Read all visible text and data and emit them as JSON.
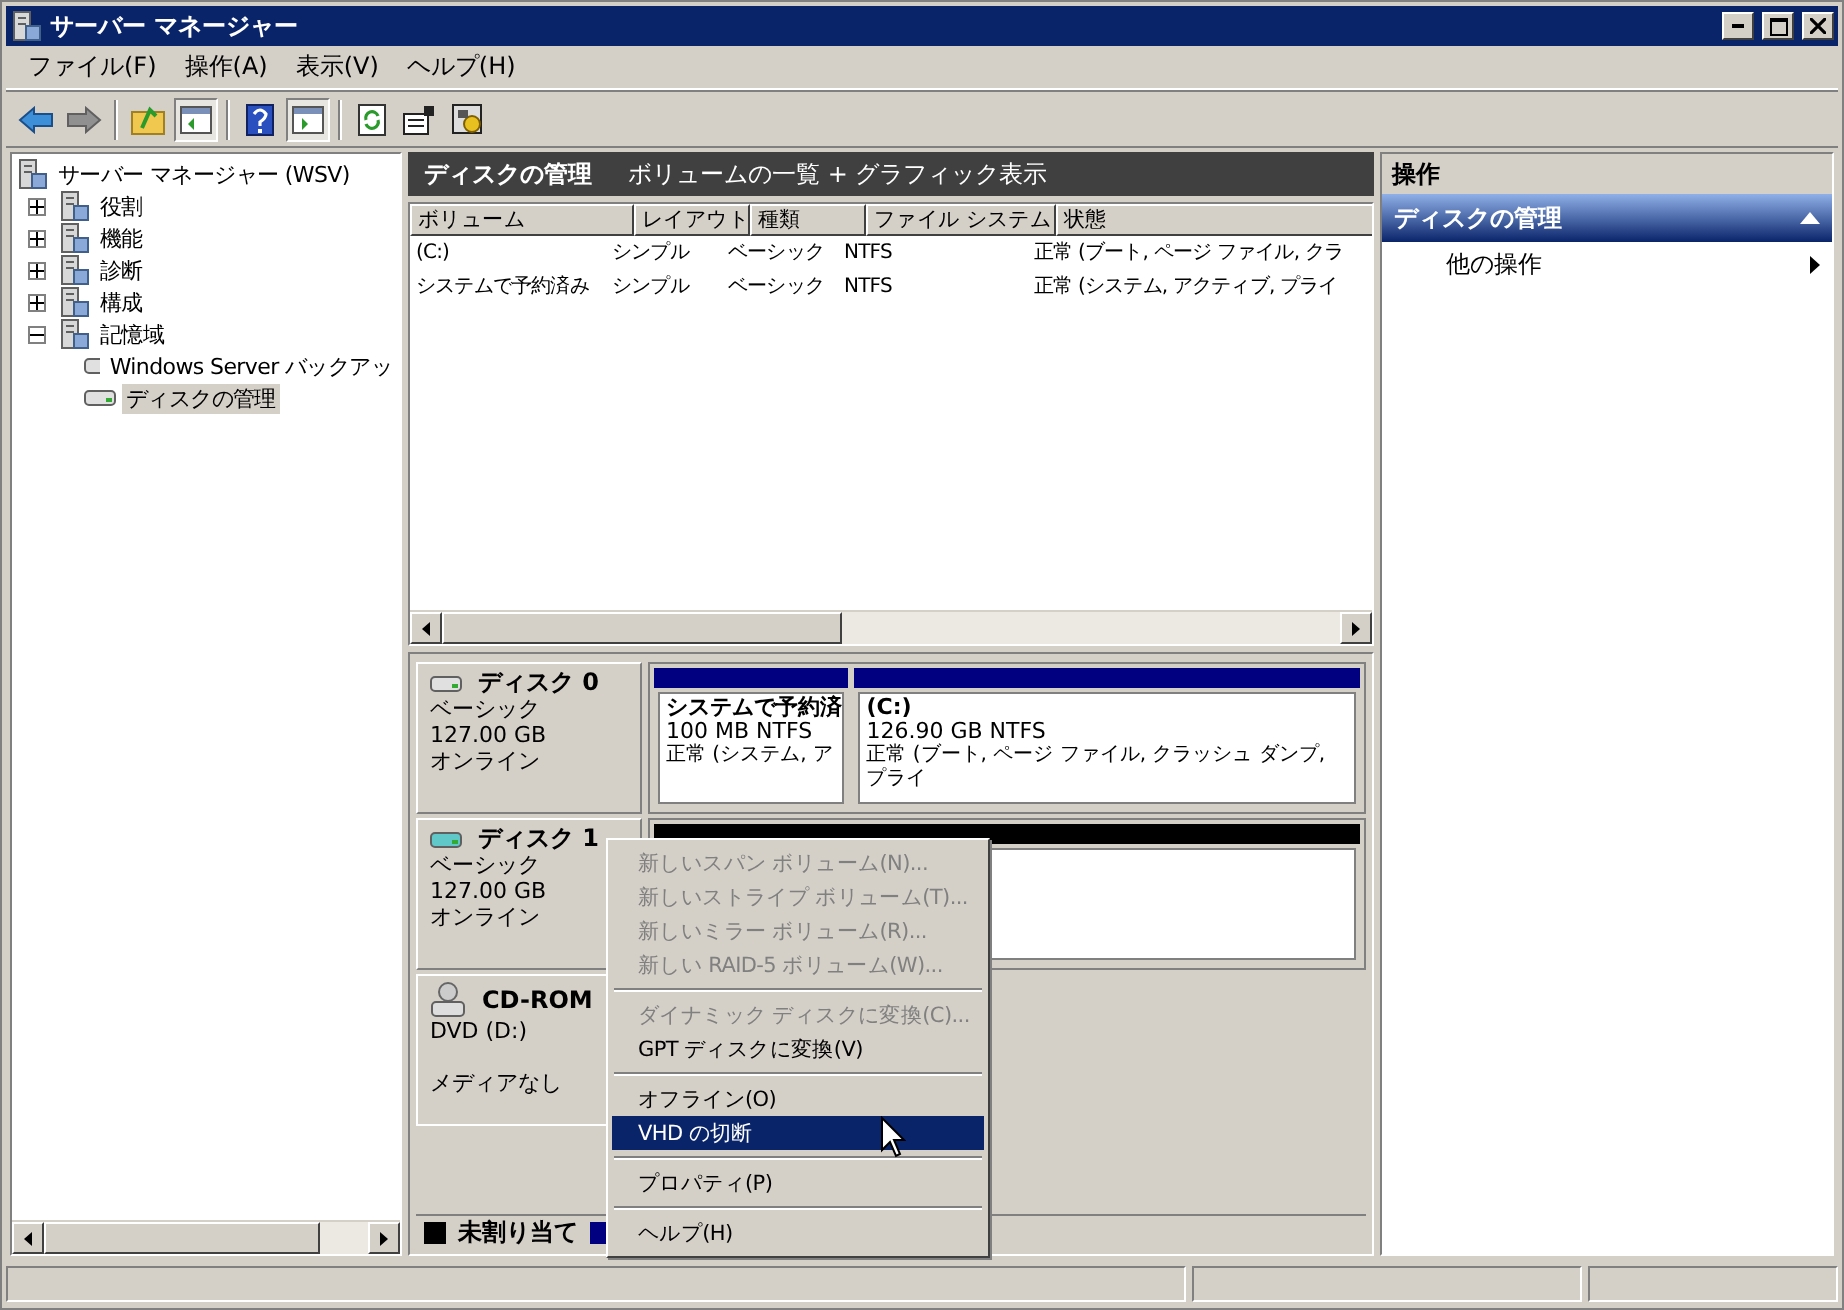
{
  "window": {
    "title": "サーバー マネージャー"
  },
  "menu_bar": [
    "ファイル(F)",
    "操作(A)",
    "表示(V)",
    "ヘルプ(H)"
  ],
  "toolbar": [
    {
      "kind": "back"
    },
    {
      "kind": "forward"
    },
    {
      "kind": "separator"
    },
    {
      "kind": "up"
    },
    {
      "kind": "tree",
      "pressed": true
    },
    {
      "kind": "separator"
    },
    {
      "kind": "help"
    },
    {
      "kind": "pane",
      "pressed": true
    },
    {
      "kind": "separator"
    },
    {
      "kind": "refresh"
    },
    {
      "kind": "properties"
    },
    {
      "kind": "settings"
    }
  ],
  "tree": {
    "label": "サーバー マネージャー (WSV)",
    "selected": false,
    "children": [
      {
        "label": "役割",
        "expanded": false,
        "selected": false
      },
      {
        "label": "機能",
        "expanded": false,
        "selected": false
      },
      {
        "label": "診断",
        "expanded": false,
        "selected": false
      },
      {
        "label": "構成",
        "expanded": false,
        "selected": false
      },
      {
        "label": "記憶域",
        "expanded": true,
        "selected": false,
        "children": [
          {
            "label": "Windows Server バックアッ",
            "selected": false
          },
          {
            "label": "ディスクの管理",
            "selected": true
          }
        ]
      }
    ]
  },
  "center": {
    "title": "ディスクの管理",
    "subtitle": "ボリュームの一覧 + グラフィック表示"
  },
  "volume_table": {
    "columns": [
      "ボリューム",
      "レイアウト",
      "種類",
      "ファイル システム",
      "状態"
    ],
    "rows": [
      [
        "(C:)",
        "シンプル",
        "ベーシック",
        "NTFS",
        "正常 (ブート, ページ ファイル, クラ"
      ],
      [
        "システムで予約済み",
        "シンプル",
        "ベーシック",
        "NTFS",
        "正常 (システム, アクティブ, プライ"
      ]
    ]
  },
  "disks": [
    {
      "kind": "disk",
      "name": "ディスク 0",
      "type": "ベーシック",
      "size": "127.00 GB",
      "status": "オンライン",
      "partitions": [
        {
          "kind": "primary",
          "name": "システムで予約済",
          "detail": "100 MB NTFS",
          "status": "正常 (システム, ア"
        },
        {
          "kind": "primary",
          "name": "(C:)",
          "detail": "126.90 GB NTFS",
          "status": "正常 (ブート, ページ ファイル, クラッシュ ダンプ, プライ"
        }
      ]
    },
    {
      "kind": "virtual",
      "name": "ディスク 1",
      "type": "ベーシック",
      "size": "127.00 GB",
      "status": "オンライン",
      "partitions": [
        {
          "kind": "unallocated"
        }
      ]
    },
    {
      "kind": "cdrom",
      "name": "CD-ROM",
      "type": "DVD (D:)",
      "status": "メディアなし"
    }
  ],
  "legend": [
    {
      "label": "未割り当て",
      "color": "#000000"
    },
    {
      "color": "#000080"
    }
  ],
  "context_menu": [
    {
      "kind": "item",
      "label": "新しいスパン ボリューム(N)...",
      "disabled": true,
      "selected": false
    },
    {
      "kind": "item",
      "label": "新しいストライプ ボリューム(T)...",
      "disabled": true,
      "selected": false
    },
    {
      "kind": "item",
      "label": "新しいミラー ボリューム(R)...",
      "disabled": true,
      "selected": false
    },
    {
      "kind": "item",
      "label": "新しい RAID-5 ボリューム(W)...",
      "disabled": true,
      "selected": false
    },
    {
      "kind": "separator"
    },
    {
      "kind": "item",
      "label": "ダイナミック ディスクに変換(C)...",
      "disabled": true,
      "selected": false
    },
    {
      "kind": "item",
      "label": "GPT ディスクに変換(V)",
      "disabled": false,
      "selected": false
    },
    {
      "kind": "separator"
    },
    {
      "kind": "item",
      "label": "オフライン(O)",
      "disabled": false,
      "selected": false
    },
    {
      "kind": "item",
      "label": "VHD の切断",
      "disabled": false,
      "selected": true
    },
    {
      "kind": "separator"
    },
    {
      "kind": "item",
      "label": "プロパティ(P)",
      "disabled": false,
      "selected": false
    },
    {
      "kind": "separator"
    },
    {
      "kind": "item",
      "label": "ヘルプ(H)",
      "disabled": false,
      "selected": false
    }
  ],
  "actions": {
    "title": "操作",
    "section": "ディスクの管理",
    "expanded": true,
    "items": [
      "他の操作"
    ]
  }
}
